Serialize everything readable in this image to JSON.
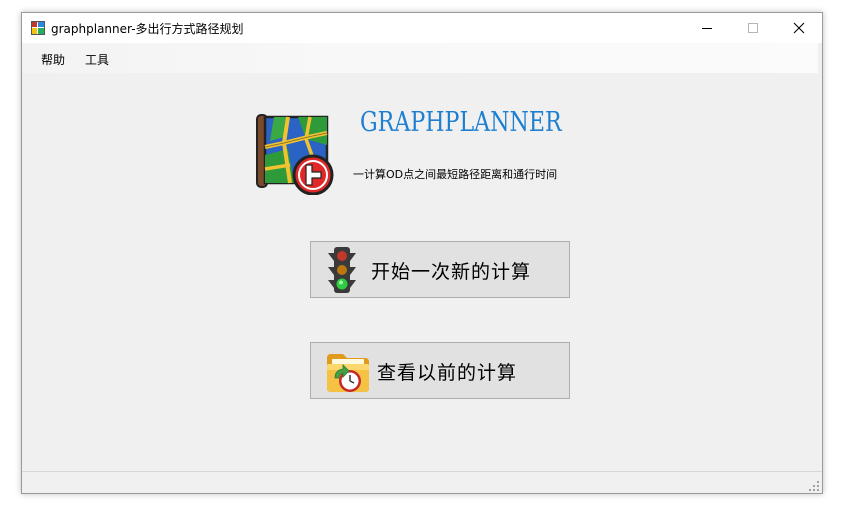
{
  "window": {
    "title": "graphplanner-多出行方式路径规划"
  },
  "menu": {
    "help": "帮助",
    "tools": "工具"
  },
  "header": {
    "app_name": "GRAPHPLANNER",
    "subtitle": "一计算OD点之间最短路径距离和通行时间"
  },
  "buttons": {
    "new_calc": "开始一次新的计算",
    "prev_calc": "查看以前的计算"
  },
  "icons": {
    "logo": "map-icon",
    "new_calc": "traffic-light-icon",
    "prev_calc": "folder-clock-icon"
  },
  "colors": {
    "app_name": "#1e7fd1",
    "button_bg": "#e1e1e1",
    "window_bg": "#f0f0f0"
  }
}
